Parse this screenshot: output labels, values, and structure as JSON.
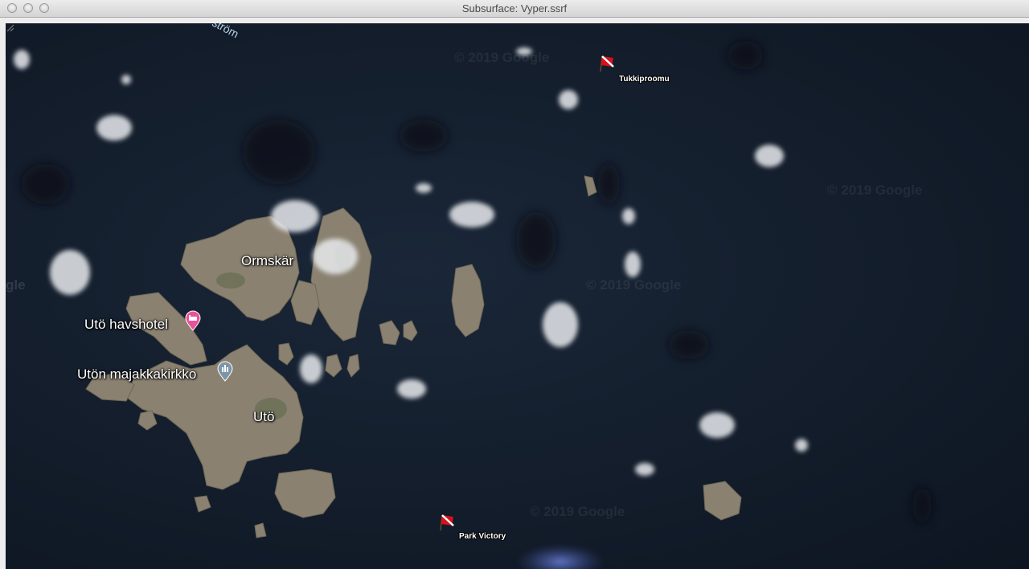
{
  "window": {
    "title": "Subsurface: Vyper.ssrf"
  },
  "map": {
    "watermark": "© 2019 Google",
    "edge_labels": {
      "top_left": "ström",
      "left": "gle"
    },
    "places": [
      {
        "label": "Ormskär"
      },
      {
        "label": "Utö havshotel",
        "icon": "hotel-pin-icon"
      },
      {
        "label": "Utön majakkakirkko",
        "icon": "landmark-pin-icon"
      },
      {
        "label": "Utö"
      }
    ],
    "dive_sites": [
      {
        "label": "Tukkiproomu",
        "icon": "dive-flag-icon"
      },
      {
        "label": "Park Victory",
        "icon": "dive-flag-icon"
      }
    ]
  },
  "colors": {
    "water": "#131d2b",
    "land": "#8a8170",
    "dive_flag_red": "#d8101c",
    "hotel_pin": "#e8529a",
    "landmark_pin": "#7e95a8"
  }
}
